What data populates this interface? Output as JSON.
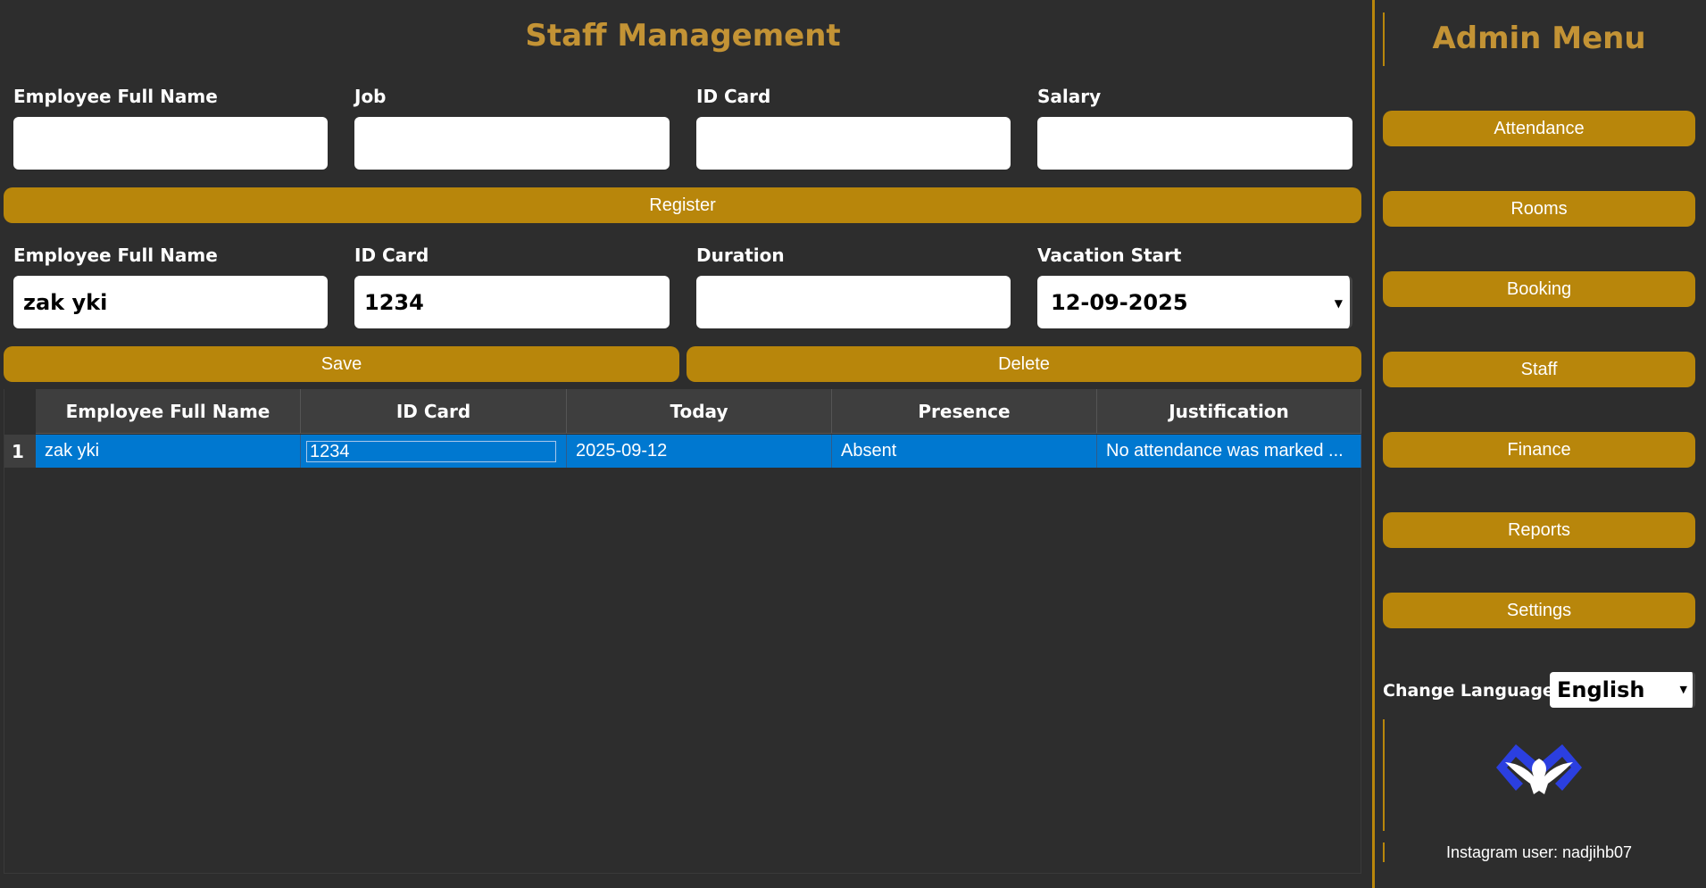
{
  "page_title": "Staff Management",
  "register_form": {
    "labels": [
      "Employee Full Name",
      "Job",
      "ID Card",
      "Salary"
    ],
    "values": [
      "",
      "",
      "",
      ""
    ],
    "register_label": "Register"
  },
  "vacation_form": {
    "labels": [
      "Employee Full Name",
      "ID Card",
      "Duration",
      "Vacation Start"
    ],
    "name_value": "zak yki",
    "id_value": "1234",
    "duration_value": "",
    "date_value": "12-09-2025",
    "save_label": "Save",
    "delete_label": "Delete"
  },
  "table": {
    "columns": [
      "Employee Full Name",
      "ID Card",
      "Today",
      "Presence",
      "Justification"
    ],
    "rows": [
      {
        "index": "1",
        "cells": [
          "zak yki",
          "1234",
          "2025-09-12",
          "Absent",
          "No attendance was marked ..."
        ]
      }
    ]
  },
  "sidebar": {
    "title": "Admin Menu",
    "items": [
      "Attendance",
      "Rooms",
      "Booking",
      "Staff",
      "Finance",
      "Reports",
      "Settings"
    ],
    "language_label": "Change Language",
    "language_value": "English",
    "footer": "Instagram user: nadjihb07",
    "logo_icon": "eagle-logo-icon"
  },
  "colors": {
    "background": "#2d2d2d",
    "accent": "#b8860b",
    "title": "#c39335",
    "selection": "#0078d0"
  }
}
